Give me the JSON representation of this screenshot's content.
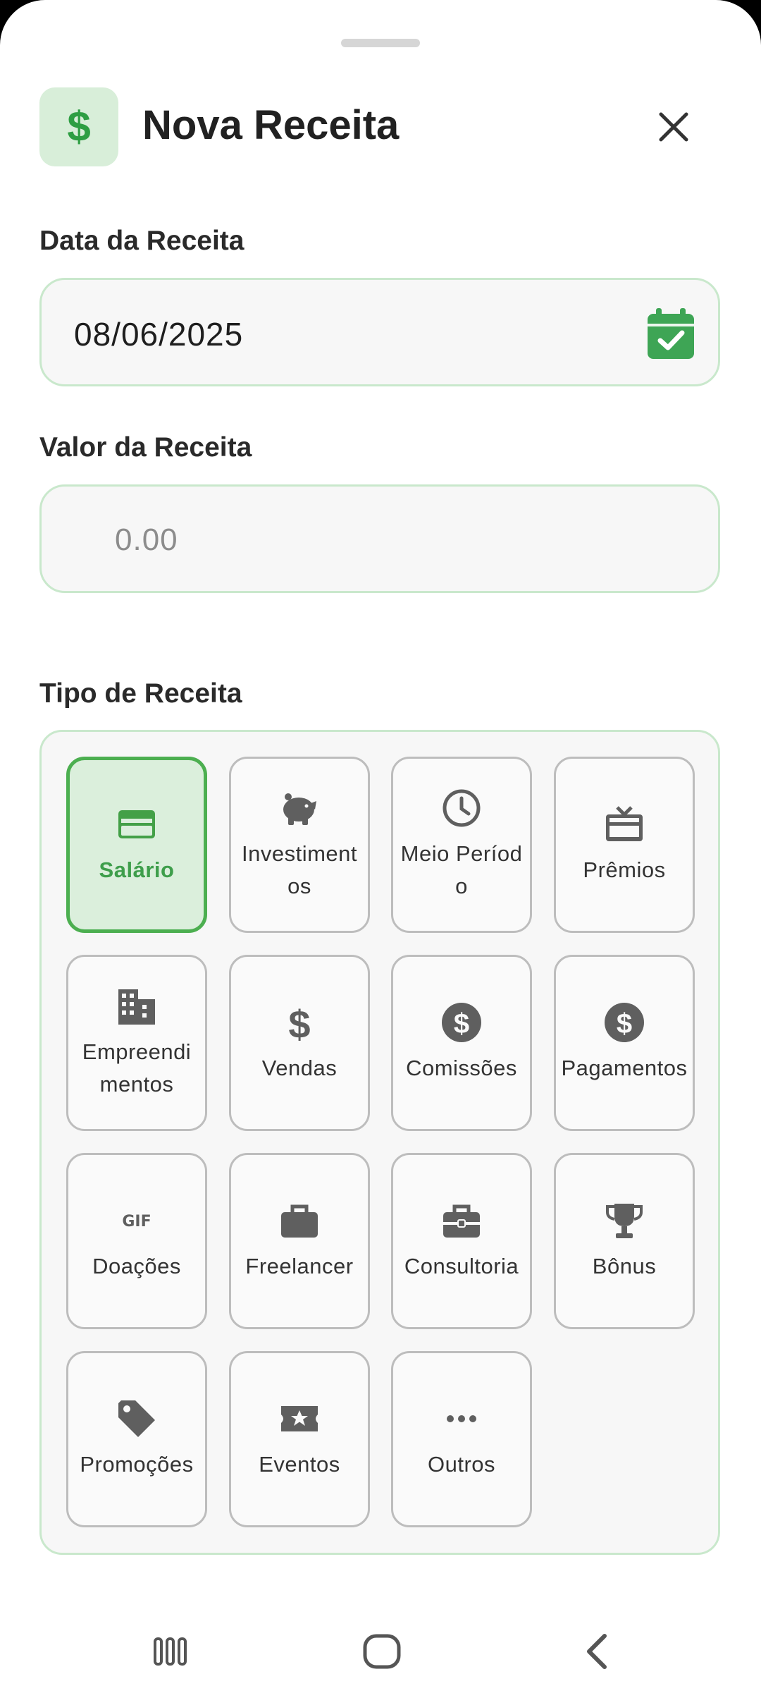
{
  "header": {
    "title": "Nova Receita",
    "icon_glyph": "$",
    "icon": "dollar-icon",
    "close_icon": "close-icon"
  },
  "date_field": {
    "label": "Data da Receita",
    "value": "08/06/2025",
    "icon": "calendar-check-icon"
  },
  "amount_field": {
    "label": "Valor da Receita",
    "placeholder": "0.00"
  },
  "types": {
    "label": "Tipo de Receita",
    "items": [
      {
        "label": "Salário",
        "icon": "credit-card-icon",
        "selected": true
      },
      {
        "label": "Investimentos",
        "icon": "piggy-bank-icon",
        "selected": false
      },
      {
        "label": "Meio Período",
        "icon": "clock-icon",
        "selected": false
      },
      {
        "label": "Prêmios",
        "icon": "gift-card-icon",
        "selected": false
      },
      {
        "label": "Empreendimentos",
        "icon": "building-icon",
        "selected": false
      },
      {
        "label": "Vendas",
        "icon": "dollar-icon",
        "selected": false
      },
      {
        "label": "Comissões",
        "icon": "dollar-circle-icon",
        "selected": false
      },
      {
        "label": "Pagamentos",
        "icon": "dollar-circle-icon",
        "selected": false
      },
      {
        "label": "Doações",
        "icon": "gif-icon",
        "selected": false
      },
      {
        "label": "Freelancer",
        "icon": "briefcase-icon",
        "selected": false
      },
      {
        "label": "Consultoria",
        "icon": "toolbox-icon",
        "selected": false
      },
      {
        "label": "Bônus",
        "icon": "trophy-icon",
        "selected": false
      },
      {
        "label": "Promoções",
        "icon": "tag-icon",
        "selected": false
      },
      {
        "label": "Eventos",
        "icon": "ticket-star-icon",
        "selected": false
      },
      {
        "label": "Outros",
        "icon": "more-horizontal-icon",
        "selected": false
      }
    ]
  },
  "system_nav": {
    "recents_icon": "recents-icon",
    "home_icon": "home-icon",
    "back_icon": "back-icon"
  },
  "colors": {
    "accent": "#4caf50",
    "accent_light": "#dbefdc",
    "field_border": "#c9e8cc",
    "icon_dark": "#5f5f5f"
  }
}
